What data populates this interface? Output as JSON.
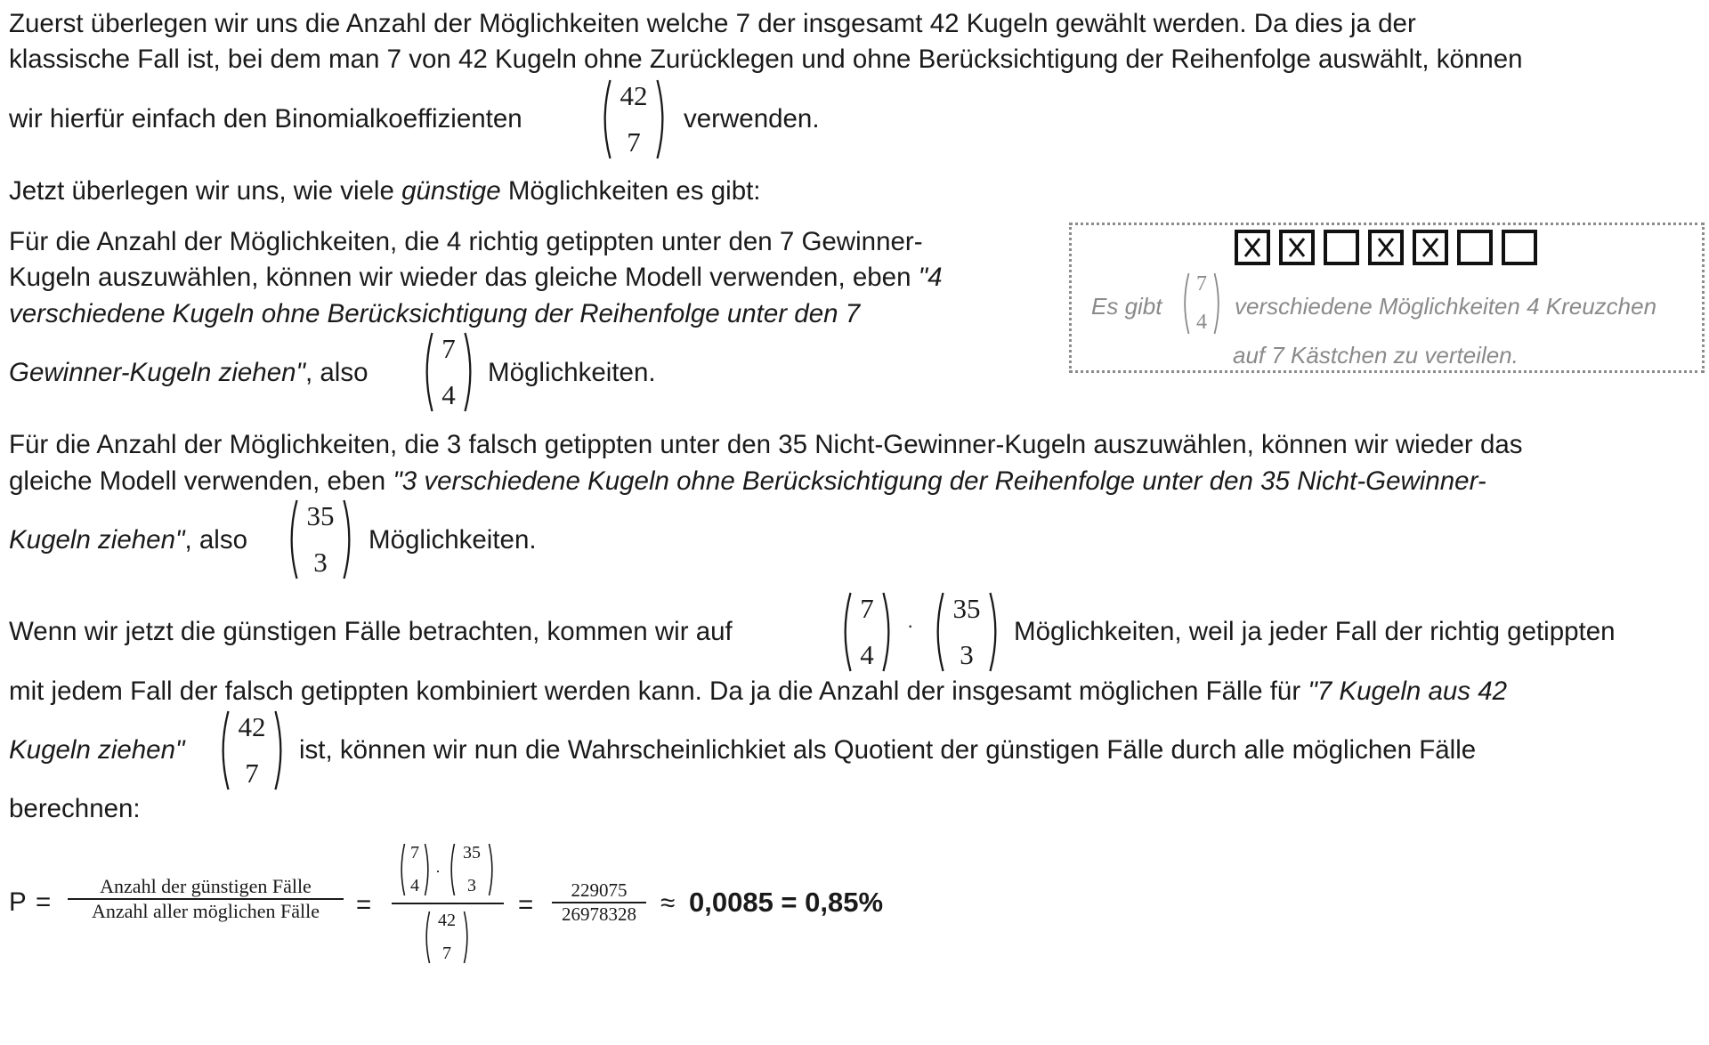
{
  "p1": {
    "l1": "Zuerst überlegen wir uns die Anzahl der Möglichkeiten welche 7 der insgesamt 42 Kugeln gewählt werden. Da dies ja der",
    "l2": "klassische Fall ist, bei dem man 7 von 42 Kugeln ohne Zurücklegen und ohne Berücksichtigung der Reihenfolge auswählt, können",
    "l3a": "wir hierfür einfach den Binomialkoeffizienten",
    "l3b": "verwenden.",
    "binom": {
      "n": "42",
      "k": "7"
    }
  },
  "p2": {
    "a": "Jetzt überlegen wir uns, wie viele ",
    "b": "günstige",
    "c": " Möglichkeiten es gibt:"
  },
  "p3": {
    "l1": "Für die Anzahl der Möglichkeiten, die 4 richtig getippten unter den 7 Gewinner-",
    "l2a": "Kugeln auszuwählen, können wir wieder das gleiche Modell verwenden, eben ",
    "l2b": "\"4",
    "l3": "verschiedene Kugeln ohne Berücksichtigung der Reihenfolge unter den 7",
    "l4a": "Gewinner-Kugeln ziehen\"",
    "l4b": ", also",
    "l4c": "Möglichkeiten.",
    "binom": {
      "n": "7",
      "k": "4"
    }
  },
  "sidebox": {
    "checkboxes": [
      true,
      true,
      false,
      true,
      true,
      false,
      false
    ],
    "text_a": "Es gibt",
    "text_b": "verschiedene Möglichkeiten 4 Kreuzchen",
    "text_c": "auf 7 Kästchen zu verteilen.",
    "binom": {
      "n": "7",
      "k": "4"
    }
  },
  "p4": {
    "l1": "Für die Anzahl der Möglichkeiten, die 3 falsch getippten unter den 35 Nicht-Gewinner-Kugeln auszuwählen, können wir wieder das",
    "l2a": "gleiche Modell verwenden, eben ",
    "l2b": "\"3 verschiedene Kugeln ohne Berücksichtigung der Reihenfolge unter den 35 Nicht-Gewinner-",
    "l3a": "Kugeln ziehen\"",
    "l3b": ", also",
    "l3c": "Möglichkeiten.",
    "binom": {
      "n": "35",
      "k": "3"
    }
  },
  "p5": {
    "l1a": "Wenn wir jetzt die günstigen Fälle betrachten, kommen wir auf",
    "l1b": "Möglichkeiten, weil ja jeder Fall der richtig getippten",
    "l2a": "mit jedem Fall der falsch getippten kombiniert werden kann. Da ja die Anzahl der insgesamt möglichen Fälle für ",
    "l2b": "\"7 Kugeln aus 42",
    "l3a": "Kugeln ziehen\"",
    "l3b": "ist, können wir nun die Wahrscheinlichkiet als Quotient der günstigen Fälle durch alle möglichen Fälle",
    "l4": "berechnen:",
    "binom1": {
      "n": "7",
      "k": "4"
    },
    "dot": "·",
    "binom2": {
      "n": "35",
      "k": "3"
    },
    "binom3": {
      "n": "42",
      "k": "7"
    }
  },
  "formula": {
    "p": "P",
    "eq": "=",
    "frac1_top": "Anzahl der günstigen Fälle",
    "frac1_bot": "Anzahl aller möglichen Fälle",
    "frac3_top": "229075",
    "frac3_bot": "26978328",
    "approx": "≈",
    "result": "0,0085 = 0,85%",
    "b1": {
      "n": "7",
      "k": "4"
    },
    "b2": {
      "n": "35",
      "k": "3"
    },
    "b3": {
      "n": "42",
      "k": "7"
    },
    "dot": "·"
  }
}
